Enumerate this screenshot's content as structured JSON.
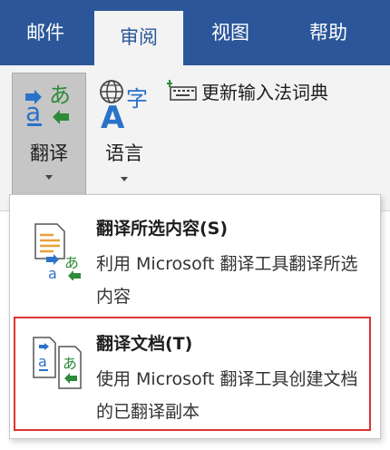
{
  "tabs": [
    {
      "label": "邮件"
    },
    {
      "label": "审阅"
    },
    {
      "label": "视图"
    },
    {
      "label": "帮助"
    }
  ],
  "ribbon": {
    "translate_label": "翻译",
    "language_label": "语言",
    "update_ime_label": "更新输入法词典"
  },
  "menu": {
    "items": [
      {
        "title": "翻译所选内容(S)",
        "description": "利用 Microsoft 翻译工具翻译所选内容",
        "icon": "translate-selection-icon"
      },
      {
        "title": "翻译文档(T)",
        "description": "使用 Microsoft 翻译工具创建文档的已翻译副本",
        "icon": "translate-document-icon"
      }
    ]
  },
  "colors": {
    "tabbar": "#2b579a",
    "ribbon": "#f3f3f3",
    "highlight": "#e03232",
    "icon_blue": "#2b72c9",
    "icon_green": "#2e8b3a",
    "icon_orange": "#e8a13a"
  }
}
